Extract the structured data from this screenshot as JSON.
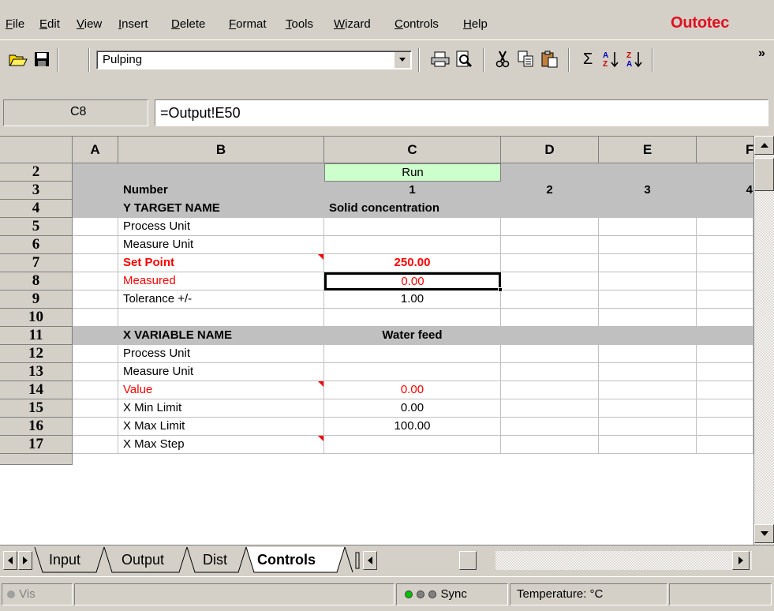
{
  "menu": {
    "items": [
      {
        "label": "File",
        "u": "F",
        "rest": "ile"
      },
      {
        "label": "Edit",
        "u": "E",
        "rest": "dit"
      },
      {
        "label": "View",
        "u": "V",
        "rest": "iew"
      },
      {
        "label": "Insert",
        "u": "I",
        "rest": "nsert"
      },
      {
        "label": "Delete",
        "u": "D",
        "rest": "elete"
      },
      {
        "label": "Format",
        "u": "F",
        "rest": "ormat"
      },
      {
        "label": "Tools",
        "u": "T",
        "rest": "ools"
      },
      {
        "label": "Wizard",
        "u": "W",
        "rest": "izard"
      },
      {
        "label": "Controls",
        "u": "C",
        "rest": "ontrols"
      },
      {
        "label": "Help",
        "u": "H",
        "rest": "elp"
      }
    ],
    "brand": "Outotec",
    "brand_color": "#e01020"
  },
  "toolbar": {
    "style_combo_value": "Pulping",
    "icons": [
      "open-folder-icon",
      "save-icon",
      "print-icon",
      "print-preview-icon",
      "cut-icon",
      "copy-icon",
      "paste-icon",
      "autosum-icon",
      "sort-ascending-icon",
      "sort-descending-icon",
      "more-icon"
    ],
    "glyphs": {
      "sum": "Σ",
      "more": "»",
      "dropdown": "▾"
    }
  },
  "formula_bar": {
    "cell_ref": "C8",
    "formula": "=Output!E50"
  },
  "grid": {
    "columns": [
      "A",
      "B",
      "C",
      "D",
      "E",
      "F"
    ],
    "rows": [
      {
        "num": "2",
        "b": "",
        "c": "Run",
        "d": "",
        "e": "",
        "f": ""
      },
      {
        "num": "3",
        "b": "Number",
        "c": "1",
        "d": "2",
        "e": "3",
        "f": "4"
      },
      {
        "num": "4",
        "b": "Y TARGET NAME",
        "c": "Solid concentration"
      },
      {
        "num": "5",
        "b": "Process Unit",
        "c": ""
      },
      {
        "num": "6",
        "b": "Measure Unit",
        "c": ""
      },
      {
        "num": "7",
        "b": "Set Point",
        "c": "250.00"
      },
      {
        "num": "8",
        "b": "Measured",
        "c": "0.00"
      },
      {
        "num": "9",
        "b": "Tolerance +/-",
        "c": "1.00"
      },
      {
        "num": "10",
        "b": "",
        "c": ""
      },
      {
        "num": "11",
        "b": "X VARIABLE NAME",
        "c": "Water feed"
      },
      {
        "num": "12",
        "b": "Process Unit",
        "c": ""
      },
      {
        "num": "13",
        "b": "Measure Unit",
        "c": ""
      },
      {
        "num": "14",
        "b": "Value",
        "c": "0.00"
      },
      {
        "num": "15",
        "b": "X Min Limit",
        "c": "0.00"
      },
      {
        "num": "16",
        "b": "X Max Limit",
        "c": "100.00"
      },
      {
        "num": "17",
        "b": "X Max Step",
        "c": ""
      }
    ],
    "colors": {
      "run_fill": "#ccffcc",
      "header_fill": "#c0c0c0",
      "red_text": "#ff0000"
    }
  },
  "sheet_tabs": [
    "Input",
    "Output",
    "Dist",
    "Controls"
  ],
  "active_sheet": "Controls",
  "status": {
    "left": "Vis",
    "sync": "Sync",
    "temperature": "Temperature: °C",
    "dot_colors": [
      "#00c000",
      "#808080",
      "#808080"
    ]
  }
}
